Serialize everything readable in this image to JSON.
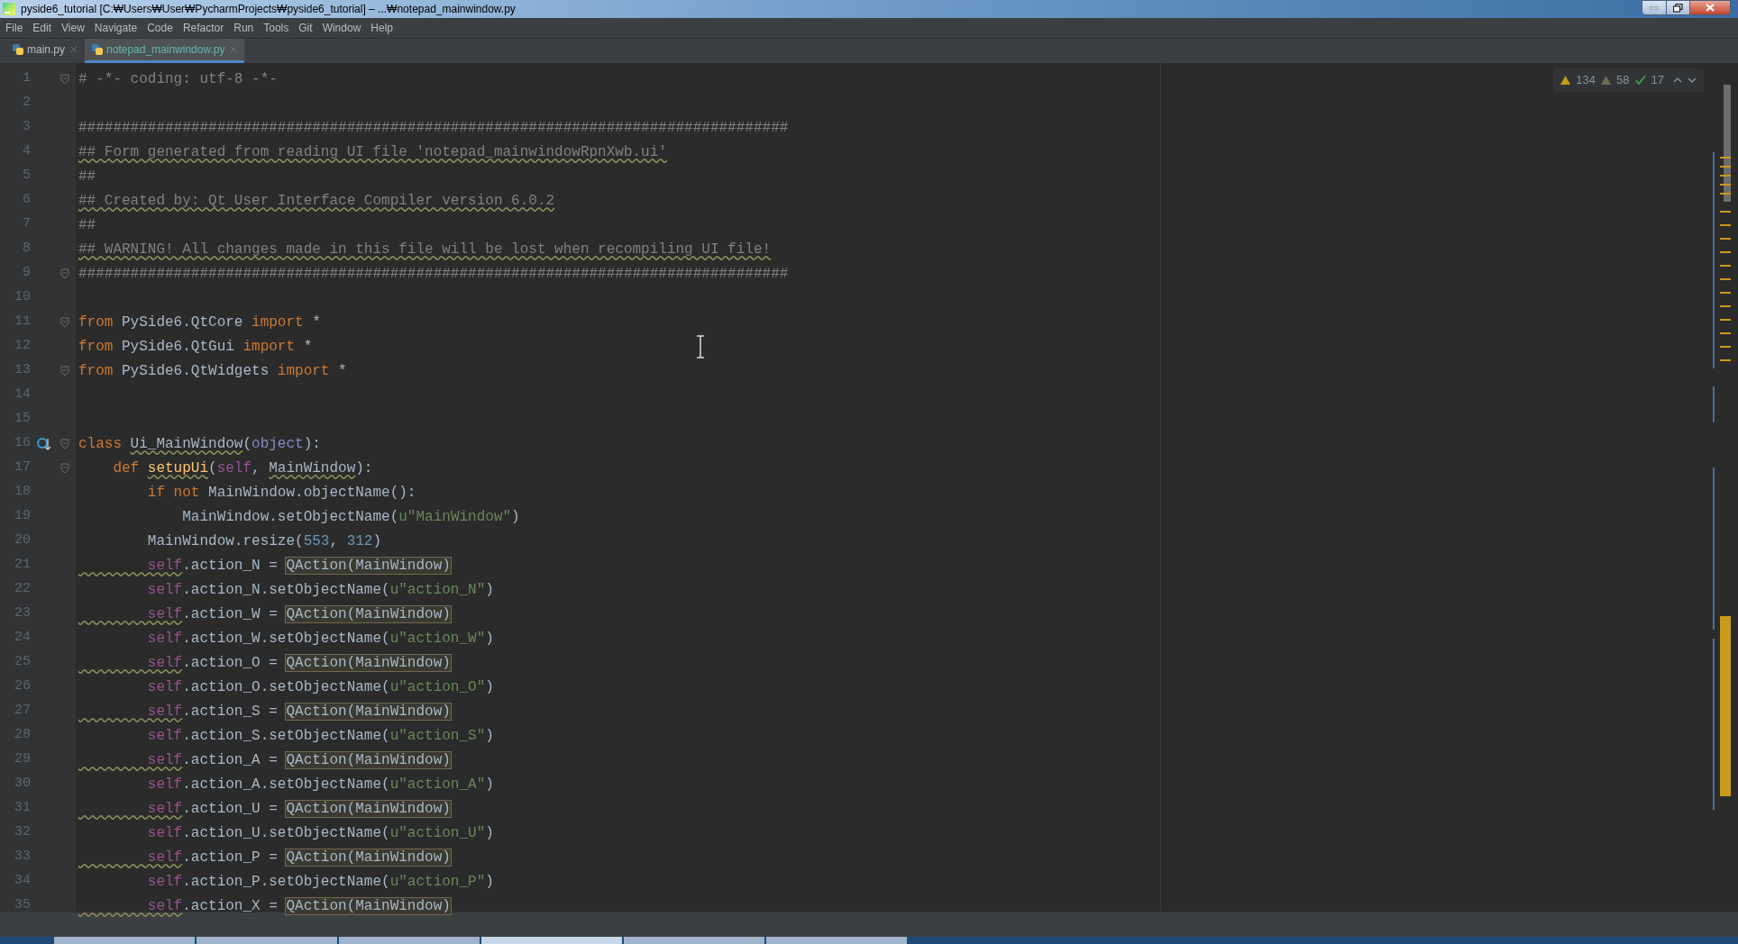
{
  "window": {
    "title": "pyside6_tutorial [C:₩Users₩User₩PycharmProjects₩pyside6_tutorial] – ...₩notepad_mainwindow.py"
  },
  "menu": [
    "File",
    "Edit",
    "View",
    "Navigate",
    "Code",
    "Refactor",
    "Run",
    "Tools",
    "Git",
    "Window",
    "Help"
  ],
  "tabs": [
    {
      "label": "main.py",
      "selected": false
    },
    {
      "label": "notepad_mainwindow.py",
      "selected": true
    }
  ],
  "inspections": {
    "warnings": "134",
    "weak_warnings": "58",
    "typos": "17"
  },
  "lines": [
    {
      "n": "1",
      "fold": true,
      "tokens": [
        {
          "kind": "comment",
          "text": "# -*- coding: utf-8 -*-"
        }
      ]
    },
    {
      "n": "2"
    },
    {
      "n": "3",
      "tokens": [
        {
          "kind": "comment",
          "text": "##################################################################################"
        }
      ]
    },
    {
      "n": "4",
      "tokens": [
        {
          "kind": "comment",
          "text": "## Form generated from reading UI file 'notepad_mainwindowRpnXwb.ui'",
          "squiggly": true
        }
      ]
    },
    {
      "n": "5",
      "tokens": [
        {
          "kind": "comment",
          "text": "##"
        }
      ]
    },
    {
      "n": "6",
      "tokens": [
        {
          "kind": "comment",
          "text": "## Created by: Qt User Interface Compiler version 6.0.2",
          "squiggly": true
        }
      ]
    },
    {
      "n": "7",
      "tokens": [
        {
          "kind": "comment",
          "text": "##"
        }
      ]
    },
    {
      "n": "8",
      "tokens": [
        {
          "kind": "comment",
          "text": "## WARNING! All changes made in this file will be lost when recompiling UI file!",
          "squiggly": true
        }
      ]
    },
    {
      "n": "9",
      "fold": true,
      "tokens": [
        {
          "kind": "comment",
          "text": "##################################################################################"
        }
      ]
    },
    {
      "n": "10"
    },
    {
      "n": "11",
      "fold": true,
      "tokens": [
        {
          "kind": "keyword",
          "text": "from"
        },
        {
          "kind": "plain",
          "text": " PySide6.QtCore "
        },
        {
          "kind": "keyword",
          "text": "import"
        },
        {
          "kind": "plain",
          "text": " *"
        }
      ]
    },
    {
      "n": "12",
      "tokens": [
        {
          "kind": "keyword",
          "text": "from"
        },
        {
          "kind": "plain",
          "text": " PySide6.QtGui "
        },
        {
          "kind": "keyword",
          "text": "import"
        },
        {
          "kind": "plain",
          "text": " *"
        }
      ]
    },
    {
      "n": "13",
      "fold": true,
      "tokens": [
        {
          "kind": "keyword",
          "text": "from"
        },
        {
          "kind": "plain",
          "text": " PySide6.QtWidgets "
        },
        {
          "kind": "keyword",
          "text": "import"
        },
        {
          "kind": "plain",
          "text": " *"
        }
      ]
    },
    {
      "n": "14"
    },
    {
      "n": "15"
    },
    {
      "n": "16",
      "fold": true,
      "marker": true,
      "tokens": [
        {
          "kind": "keyword",
          "text": "class "
        },
        {
          "kind": "plain",
          "text": "Ui_MainWindow",
          "squiggly": true
        },
        {
          "kind": "plain",
          "text": "("
        },
        {
          "kind": "builtin",
          "text": "object"
        },
        {
          "kind": "plain",
          "text": "):"
        }
      ]
    },
    {
      "n": "17",
      "fold": true,
      "tokens": [
        {
          "kind": "keyword",
          "text": "    def "
        },
        {
          "kind": "function",
          "text": "setupUi",
          "squiggly": true
        },
        {
          "kind": "plain",
          "text": "("
        },
        {
          "kind": "self",
          "text": "self"
        },
        {
          "kind": "plain",
          "text": ", "
        },
        {
          "kind": "plain",
          "text": "MainWindow",
          "squiggly": true
        },
        {
          "kind": "plain",
          "text": "):"
        }
      ]
    },
    {
      "n": "18",
      "tokens": [
        {
          "kind": "keyword",
          "text": "        if not"
        },
        {
          "kind": "plain",
          "text": " MainWindow.objectName():"
        }
      ]
    },
    {
      "n": "19",
      "tokens": [
        {
          "kind": "plain",
          "text": "            MainWindow.setObjectName("
        },
        {
          "kind": "string",
          "text": "u\"MainWindow\""
        },
        {
          "kind": "plain",
          "text": ")"
        }
      ]
    },
    {
      "n": "20",
      "tokens": [
        {
          "kind": "plain",
          "text": "        MainWindow.resize("
        },
        {
          "kind": "number",
          "text": "553"
        },
        {
          "kind": "plain",
          "text": ", "
        },
        {
          "kind": "number",
          "text": "312"
        },
        {
          "kind": "plain",
          "text": ")"
        }
      ]
    },
    {
      "n": "21",
      "tokens": [
        {
          "kind": "self",
          "text": "        self",
          "squiggly": true
        },
        {
          "kind": "plain",
          "text": ".action_N = "
        },
        {
          "kind": "plain",
          "text": "QAction(MainWindow)",
          "boxed": true
        }
      ]
    },
    {
      "n": "22",
      "tokens": [
        {
          "kind": "self",
          "text": "        self"
        },
        {
          "kind": "plain",
          "text": ".action_N.setObjectName("
        },
        {
          "kind": "string",
          "text": "u\"action_N\""
        },
        {
          "kind": "plain",
          "text": ")"
        }
      ]
    },
    {
      "n": "23",
      "tokens": [
        {
          "kind": "self",
          "text": "        self",
          "squiggly": true
        },
        {
          "kind": "plain",
          "text": ".action_W = "
        },
        {
          "kind": "plain",
          "text": "QAction(MainWindow)",
          "boxed": true
        }
      ]
    },
    {
      "n": "24",
      "tokens": [
        {
          "kind": "self",
          "text": "        self"
        },
        {
          "kind": "plain",
          "text": ".action_W.setObjectName("
        },
        {
          "kind": "string",
          "text": "u\"action_W\""
        },
        {
          "kind": "plain",
          "text": ")"
        }
      ]
    },
    {
      "n": "25",
      "tokens": [
        {
          "kind": "self",
          "text": "        self",
          "squiggly": true
        },
        {
          "kind": "plain",
          "text": ".action_O = "
        },
        {
          "kind": "plain",
          "text": "QAction(MainWindow)",
          "boxed": true
        }
      ]
    },
    {
      "n": "26",
      "tokens": [
        {
          "kind": "self",
          "text": "        self"
        },
        {
          "kind": "plain",
          "text": ".action_O.setObjectName("
        },
        {
          "kind": "string",
          "text": "u\"action_O\""
        },
        {
          "kind": "plain",
          "text": ")"
        }
      ]
    },
    {
      "n": "27",
      "tokens": [
        {
          "kind": "self",
          "text": "        self",
          "squiggly": true
        },
        {
          "kind": "plain",
          "text": ".action_S = "
        },
        {
          "kind": "plain",
          "text": "QAction(MainWindow)",
          "boxed": true
        }
      ]
    },
    {
      "n": "28",
      "tokens": [
        {
          "kind": "self",
          "text": "        self"
        },
        {
          "kind": "plain",
          "text": ".action_S.setObjectName("
        },
        {
          "kind": "string",
          "text": "u\"action_S\""
        },
        {
          "kind": "plain",
          "text": ")"
        }
      ]
    },
    {
      "n": "29",
      "tokens": [
        {
          "kind": "self",
          "text": "        self",
          "squiggly": true
        },
        {
          "kind": "plain",
          "text": ".action_A = "
        },
        {
          "kind": "plain",
          "text": "QAction(MainWindow)",
          "boxed": true
        }
      ]
    },
    {
      "n": "30",
      "tokens": [
        {
          "kind": "self",
          "text": "        self"
        },
        {
          "kind": "plain",
          "text": ".action_A.setObjectName("
        },
        {
          "kind": "string",
          "text": "u\"action_A\""
        },
        {
          "kind": "plain",
          "text": ")"
        }
      ]
    },
    {
      "n": "31",
      "tokens": [
        {
          "kind": "self",
          "text": "        self",
          "squiggly": true
        },
        {
          "kind": "plain",
          "text": ".action_U = "
        },
        {
          "kind": "plain",
          "text": "QAction(MainWindow)",
          "boxed": true
        }
      ]
    },
    {
      "n": "32",
      "tokens": [
        {
          "kind": "self",
          "text": "        self"
        },
        {
          "kind": "plain",
          "text": ".action_U.setObjectName("
        },
        {
          "kind": "string",
          "text": "u\"action_U\""
        },
        {
          "kind": "plain",
          "text": ")"
        }
      ]
    },
    {
      "n": "33",
      "tokens": [
        {
          "kind": "self",
          "text": "        self",
          "squiggly": true
        },
        {
          "kind": "plain",
          "text": ".action_P = "
        },
        {
          "kind": "plain",
          "text": "QAction(MainWindow)",
          "boxed": true
        }
      ]
    },
    {
      "n": "34",
      "tokens": [
        {
          "kind": "self",
          "text": "        self"
        },
        {
          "kind": "plain",
          "text": ".action_P.setObjectName("
        },
        {
          "kind": "string",
          "text": "u\"action_P\""
        },
        {
          "kind": "plain",
          "text": ")"
        }
      ]
    },
    {
      "n": "35",
      "tokens": [
        {
          "kind": "self",
          "text": "        self",
          "squiggly": true
        },
        {
          "kind": "plain",
          "text": ".action_X = "
        },
        {
          "kind": "plain",
          "text": "QAction(MainWindow)",
          "boxed": true
        }
      ]
    }
  ]
}
